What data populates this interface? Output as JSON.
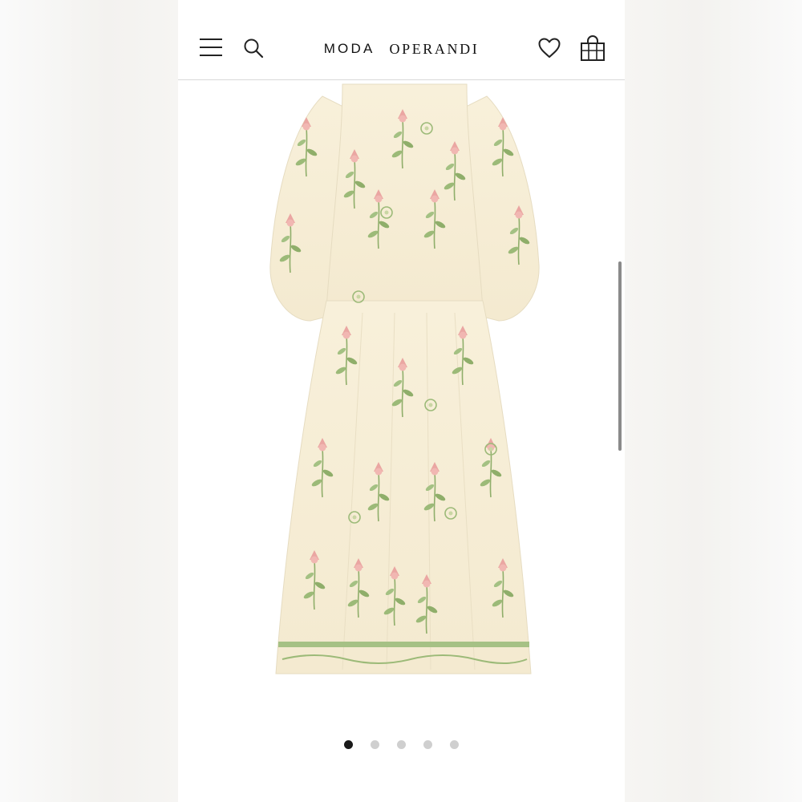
{
  "header": {
    "logo_word1": "MODA",
    "logo_word2": "OPERANDI",
    "icons": [
      "menu-icon",
      "search-icon",
      "heart-icon",
      "shopping-bag-icon"
    ]
  },
  "product": {
    "image": "floral-midi-dress",
    "colors": {
      "fabric": "#f7efd9",
      "leaf": "#8fae6a",
      "flower": "#e9a2a0"
    }
  },
  "carousel": {
    "count": 5,
    "active_index": 0
  }
}
